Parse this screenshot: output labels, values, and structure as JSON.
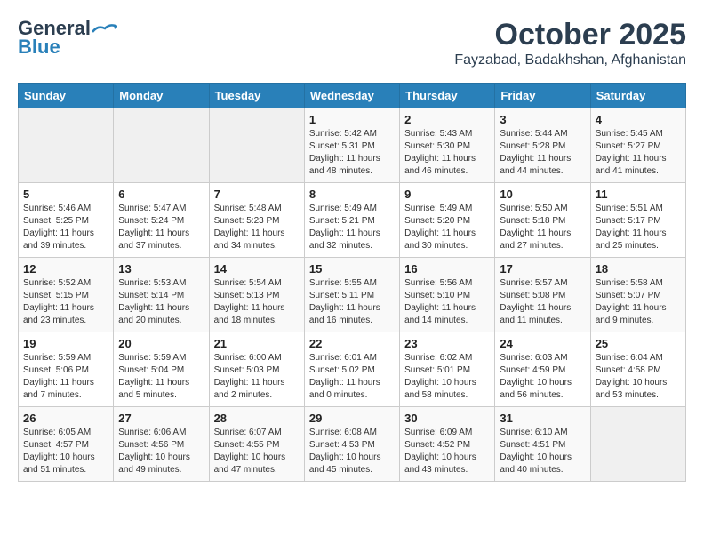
{
  "header": {
    "logo_line1": "General",
    "logo_line2": "Blue",
    "title": "October 2025",
    "subtitle": "Fayzabad, Badakhshan, Afghanistan"
  },
  "days_of_week": [
    "Sunday",
    "Monday",
    "Tuesday",
    "Wednesday",
    "Thursday",
    "Friday",
    "Saturday"
  ],
  "weeks": [
    [
      {
        "day": "",
        "info": ""
      },
      {
        "day": "",
        "info": ""
      },
      {
        "day": "",
        "info": ""
      },
      {
        "day": "1",
        "info": "Sunrise: 5:42 AM\nSunset: 5:31 PM\nDaylight: 11 hours\nand 48 minutes."
      },
      {
        "day": "2",
        "info": "Sunrise: 5:43 AM\nSunset: 5:30 PM\nDaylight: 11 hours\nand 46 minutes."
      },
      {
        "day": "3",
        "info": "Sunrise: 5:44 AM\nSunset: 5:28 PM\nDaylight: 11 hours\nand 44 minutes."
      },
      {
        "day": "4",
        "info": "Sunrise: 5:45 AM\nSunset: 5:27 PM\nDaylight: 11 hours\nand 41 minutes."
      }
    ],
    [
      {
        "day": "5",
        "info": "Sunrise: 5:46 AM\nSunset: 5:25 PM\nDaylight: 11 hours\nand 39 minutes."
      },
      {
        "day": "6",
        "info": "Sunrise: 5:47 AM\nSunset: 5:24 PM\nDaylight: 11 hours\nand 37 minutes."
      },
      {
        "day": "7",
        "info": "Sunrise: 5:48 AM\nSunset: 5:23 PM\nDaylight: 11 hours\nand 34 minutes."
      },
      {
        "day": "8",
        "info": "Sunrise: 5:49 AM\nSunset: 5:21 PM\nDaylight: 11 hours\nand 32 minutes."
      },
      {
        "day": "9",
        "info": "Sunrise: 5:49 AM\nSunset: 5:20 PM\nDaylight: 11 hours\nand 30 minutes."
      },
      {
        "day": "10",
        "info": "Sunrise: 5:50 AM\nSunset: 5:18 PM\nDaylight: 11 hours\nand 27 minutes."
      },
      {
        "day": "11",
        "info": "Sunrise: 5:51 AM\nSunset: 5:17 PM\nDaylight: 11 hours\nand 25 minutes."
      }
    ],
    [
      {
        "day": "12",
        "info": "Sunrise: 5:52 AM\nSunset: 5:15 PM\nDaylight: 11 hours\nand 23 minutes."
      },
      {
        "day": "13",
        "info": "Sunrise: 5:53 AM\nSunset: 5:14 PM\nDaylight: 11 hours\nand 20 minutes."
      },
      {
        "day": "14",
        "info": "Sunrise: 5:54 AM\nSunset: 5:13 PM\nDaylight: 11 hours\nand 18 minutes."
      },
      {
        "day": "15",
        "info": "Sunrise: 5:55 AM\nSunset: 5:11 PM\nDaylight: 11 hours\nand 16 minutes."
      },
      {
        "day": "16",
        "info": "Sunrise: 5:56 AM\nSunset: 5:10 PM\nDaylight: 11 hours\nand 14 minutes."
      },
      {
        "day": "17",
        "info": "Sunrise: 5:57 AM\nSunset: 5:08 PM\nDaylight: 11 hours\nand 11 minutes."
      },
      {
        "day": "18",
        "info": "Sunrise: 5:58 AM\nSunset: 5:07 PM\nDaylight: 11 hours\nand 9 minutes."
      }
    ],
    [
      {
        "day": "19",
        "info": "Sunrise: 5:59 AM\nSunset: 5:06 PM\nDaylight: 11 hours\nand 7 minutes."
      },
      {
        "day": "20",
        "info": "Sunrise: 5:59 AM\nSunset: 5:04 PM\nDaylight: 11 hours\nand 5 minutes."
      },
      {
        "day": "21",
        "info": "Sunrise: 6:00 AM\nSunset: 5:03 PM\nDaylight: 11 hours\nand 2 minutes."
      },
      {
        "day": "22",
        "info": "Sunrise: 6:01 AM\nSunset: 5:02 PM\nDaylight: 11 hours\nand 0 minutes."
      },
      {
        "day": "23",
        "info": "Sunrise: 6:02 AM\nSunset: 5:01 PM\nDaylight: 10 hours\nand 58 minutes."
      },
      {
        "day": "24",
        "info": "Sunrise: 6:03 AM\nSunset: 4:59 PM\nDaylight: 10 hours\nand 56 minutes."
      },
      {
        "day": "25",
        "info": "Sunrise: 6:04 AM\nSunset: 4:58 PM\nDaylight: 10 hours\nand 53 minutes."
      }
    ],
    [
      {
        "day": "26",
        "info": "Sunrise: 6:05 AM\nSunset: 4:57 PM\nDaylight: 10 hours\nand 51 minutes."
      },
      {
        "day": "27",
        "info": "Sunrise: 6:06 AM\nSunset: 4:56 PM\nDaylight: 10 hours\nand 49 minutes."
      },
      {
        "day": "28",
        "info": "Sunrise: 6:07 AM\nSunset: 4:55 PM\nDaylight: 10 hours\nand 47 minutes."
      },
      {
        "day": "29",
        "info": "Sunrise: 6:08 AM\nSunset: 4:53 PM\nDaylight: 10 hours\nand 45 minutes."
      },
      {
        "day": "30",
        "info": "Sunrise: 6:09 AM\nSunset: 4:52 PM\nDaylight: 10 hours\nand 43 minutes."
      },
      {
        "day": "31",
        "info": "Sunrise: 6:10 AM\nSunset: 4:51 PM\nDaylight: 10 hours\nand 40 minutes."
      },
      {
        "day": "",
        "info": ""
      }
    ]
  ]
}
